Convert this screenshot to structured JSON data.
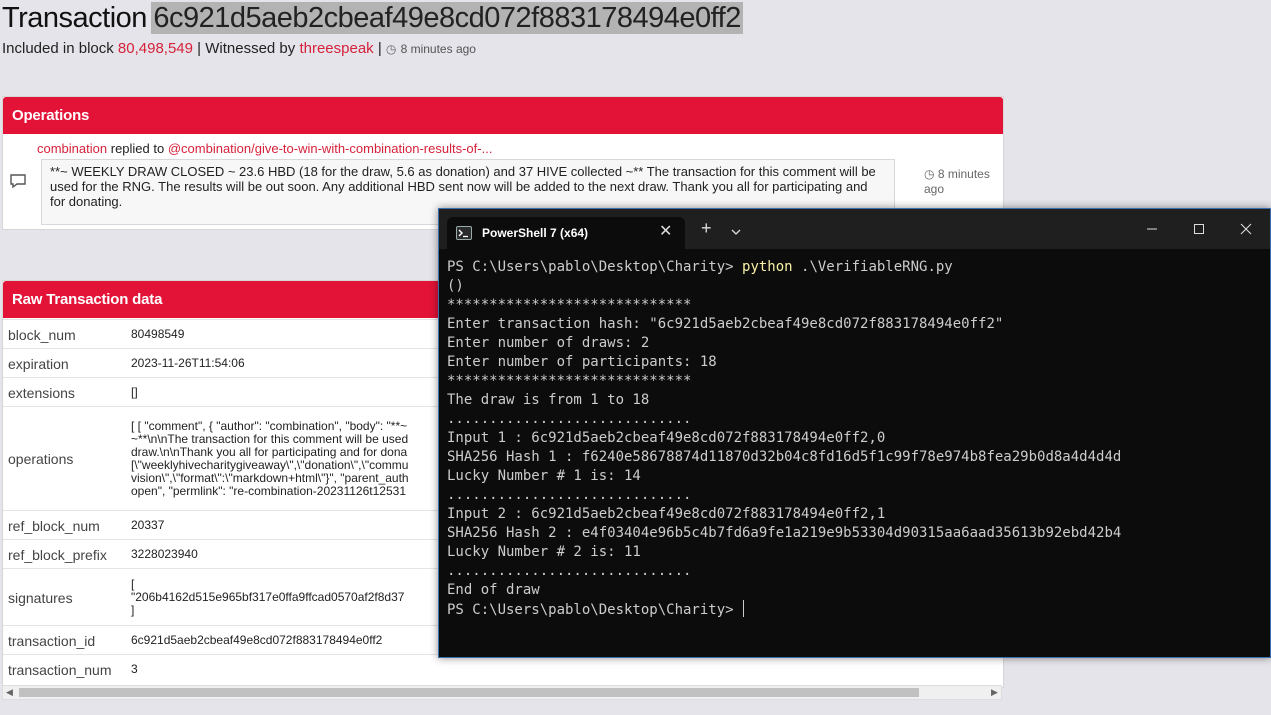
{
  "header": {
    "title_word": "Transaction",
    "tx_hash": "6c921d5aeb2cbeaf49e8cd072f883178494e0ff2",
    "included_label": "Included in block",
    "block_number": "80,498,549",
    "witness_label": "| Witnessed by",
    "witness_name": "threespeak",
    "separator": "|",
    "time_ago": "8 minutes ago"
  },
  "operations": {
    "heading": "Operations",
    "author": "combination",
    "action": "replied to",
    "target": "@combination/give-to-win-with-combination-results-of-...",
    "body": "**~ WEEKLY DRAW CLOSED ~ 23.6 HBD (18 for the draw, 5.6 as donation) and 37 HIVE collected ~** The transaction for this comment will be used for the RNG. The results will be out soon. Any additional HBD sent now will be added to the next draw. Thank you all for participating and for donating.",
    "time": "8 minutes ago",
    "comment_icon": "comment-icon",
    "clock_icon": "clock-icon"
  },
  "raw": {
    "heading": "Raw Transaction data",
    "rows": [
      {
        "key": "block_num",
        "lines": [
          "80498549"
        ]
      },
      {
        "key": "expiration",
        "lines": [
          "2023-11-26T11:54:06"
        ]
      },
      {
        "key": "extensions",
        "lines": [
          "[]"
        ]
      },
      {
        "key": "operations",
        "lines": [
          "[ [ \"comment\", { \"author\": \"combination\", \"body\": \"**~",
          "~**\\n\\nThe transaction for this comment will be used",
          "draw.\\n\\nThank you all for participating and for dona",
          "[\\\"weeklyhivecharitygiveaway\\\",\\\"donation\\\",\\\"commu",
          "vision\\\",\\\"format\\\":\\\"markdown+html\\\"}\", \"parent_auth",
          "open\", \"permlink\": \"re-combination-20231126t12531"
        ]
      },
      {
        "key": "ref_block_num",
        "lines": [
          "20337"
        ]
      },
      {
        "key": "ref_block_prefix",
        "lines": [
          "3228023940"
        ]
      },
      {
        "key": "signatures",
        "lines": [
          "[",
          "\"206b4162d515e965bf317e0ffa9ffcad0570af2f8d37",
          "]"
        ]
      },
      {
        "key": "transaction_id",
        "lines": [
          "6c921d5aeb2cbeaf49e8cd072f883178494e0ff2"
        ]
      },
      {
        "key": "transaction_num",
        "lines": [
          "3"
        ]
      }
    ]
  },
  "powershell": {
    "tab_title": "PowerShell 7 (x64)",
    "tab_close": "✕",
    "new_tab": "+",
    "lines": [
      {
        "prompt": "PS C:\\Users\\pablo\\Desktop\\Charity> ",
        "cmd": "python",
        "rest": " .\\VerifiableRNG.py"
      },
      {
        "text": "()"
      },
      {
        "text": "*****************************"
      },
      {
        "text": "Enter transaction hash: \"6c921d5aeb2cbeaf49e8cd072f883178494e0ff2\""
      },
      {
        "text": "Enter number of draws: 2"
      },
      {
        "text": "Enter number of participants: 18"
      },
      {
        "text": "*****************************"
      },
      {
        "text": "The draw is from 1 to 18"
      },
      {
        "text": "............................."
      },
      {
        "text": "Input 1 : 6c921d5aeb2cbeaf49e8cd072f883178494e0ff2,0"
      },
      {
        "text": "SHA256 Hash 1 : f6240e58678874d11870d32b04c8fd16d5f1c99f78e974b8fea29b0d8a4d4d4d"
      },
      {
        "text": "Lucky Number # 1 is: 14"
      },
      {
        "text": "............................."
      },
      {
        "text": "Input 2 : 6c921d5aeb2cbeaf49e8cd072f883178494e0ff2,1"
      },
      {
        "text": "SHA256 Hash 2 : e4f03404e96b5c4b7fd6a9fe1a219e9b53304d90315aa6aad35613b92ebd42b4"
      },
      {
        "text": "Lucky Number # 2 is: 11"
      },
      {
        "text": "............................."
      },
      {
        "text": "End of draw"
      },
      {
        "text": "PS C:\\Users\\pablo\\Desktop\\Charity> ",
        "cursor": true
      }
    ]
  }
}
